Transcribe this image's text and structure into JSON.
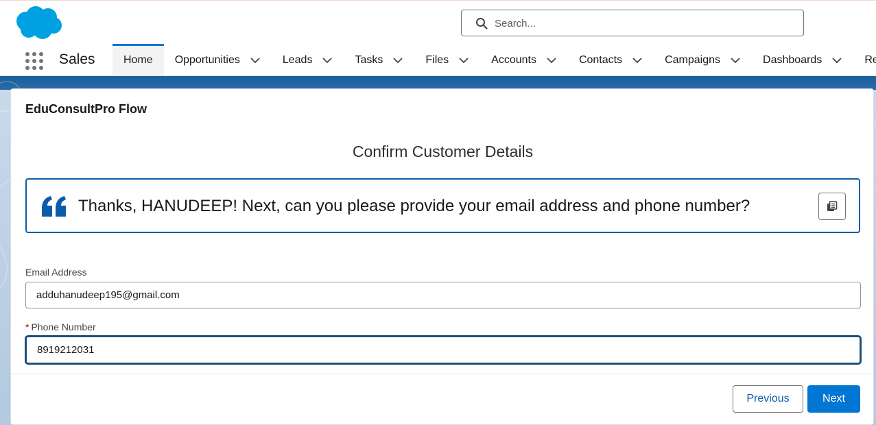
{
  "header": {
    "logo_icon": "salesforce-cloud-logo",
    "search": {
      "placeholder": "Search...",
      "value": ""
    }
  },
  "nav": {
    "app_name": "Sales",
    "items": [
      {
        "label": "Home",
        "active": true,
        "has_dropdown": false
      },
      {
        "label": "Opportunities",
        "has_dropdown": true
      },
      {
        "label": "Leads",
        "has_dropdown": true
      },
      {
        "label": "Tasks",
        "has_dropdown": true
      },
      {
        "label": "Files",
        "has_dropdown": true
      },
      {
        "label": "Accounts",
        "has_dropdown": true
      },
      {
        "label": "Contacts",
        "has_dropdown": true
      },
      {
        "label": "Campaigns",
        "has_dropdown": true
      },
      {
        "label": "Dashboards",
        "has_dropdown": true
      },
      {
        "label": "Rep",
        "has_dropdown": false
      }
    ]
  },
  "flow": {
    "title": "EduConsultPro Flow",
    "screen_title": "Confirm Customer Details",
    "message": "Thanks, HANUDEEP! Next, can you please provide your email address and phone number?",
    "fields": {
      "email": {
        "label": "Email Address",
        "value": "adduhanudeep195@gmail.com",
        "required": false
      },
      "phone": {
        "label": "Phone Number",
        "value": "8919212031",
        "required": true,
        "required_mark": "*"
      }
    },
    "buttons": {
      "previous": "Previous",
      "next": "Next"
    }
  },
  "colors": {
    "brand_blue": "#0176d3",
    "focus_border": "#1b4f7e",
    "quote_border": "#0b5cab",
    "required": "#ba0517"
  }
}
